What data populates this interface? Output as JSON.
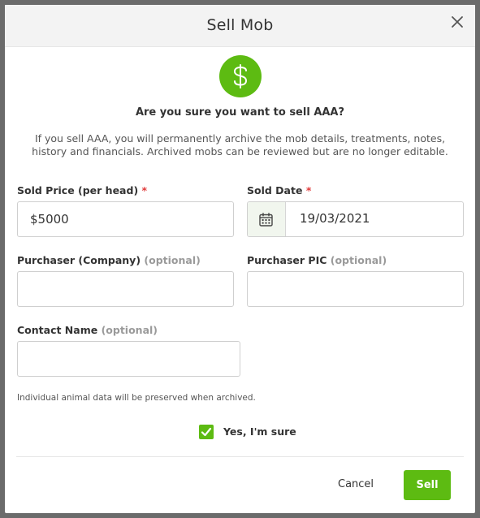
{
  "dialog": {
    "title": "Sell Mob",
    "icon": "dollar-icon",
    "question": "Are you sure you want to sell AAA?",
    "warning": "If you sell AAA, you will permanently archive the mob details, treatments, notes, history and financials. Archived mobs can be reviewed but are no longer editable."
  },
  "fields": {
    "sold_price": {
      "label": "Sold Price (per head)",
      "required_mark": "*",
      "value": "$5000"
    },
    "sold_date": {
      "label": "Sold Date",
      "required_mark": "*",
      "value": "19/03/2021"
    },
    "purchaser_company": {
      "label": "Purchaser (Company)",
      "optional_text": "(optional)",
      "value": ""
    },
    "purchaser_pic": {
      "label": "Purchaser PIC",
      "optional_text": "(optional)",
      "value": ""
    },
    "contact_name": {
      "label": "Contact Name",
      "optional_text": "(optional)",
      "value": ""
    }
  },
  "footnote": "Individual animal data will be preserved when archived.",
  "confirmation": {
    "label": "Yes, I'm sure",
    "checked": true
  },
  "actions": {
    "cancel_label": "Cancel",
    "sell_label": "Sell"
  },
  "colors": {
    "accent": "#5dbb12",
    "required": "#e03a3a",
    "optional": "#9a9a9a"
  }
}
